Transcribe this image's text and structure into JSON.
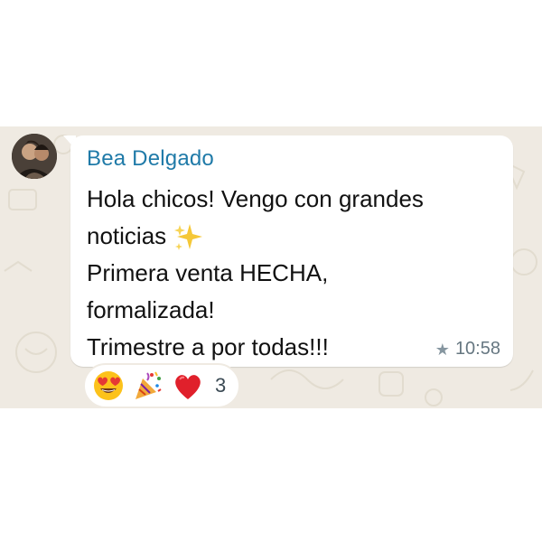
{
  "message": {
    "sender_name": "Bea Delgado",
    "lines": [
      "Hola chicos! Vengo con grandes",
      "noticias",
      "Primera venta HECHA,",
      "formalizada!",
      "Trimestre a por todas!!!"
    ],
    "timestamp": "10:58",
    "starred": true,
    "inline_emoji": "sparkles-icon"
  },
  "reactions": {
    "emojis": [
      "heart-eyes-face-icon",
      "party-popper-icon",
      "red-heart-icon"
    ],
    "count": "3"
  },
  "colors": {
    "chat_background": "#efeae2",
    "bubble": "#ffffff",
    "sender_name": "#1f7aa8",
    "message_text": "#111111",
    "meta_text": "#667781"
  }
}
